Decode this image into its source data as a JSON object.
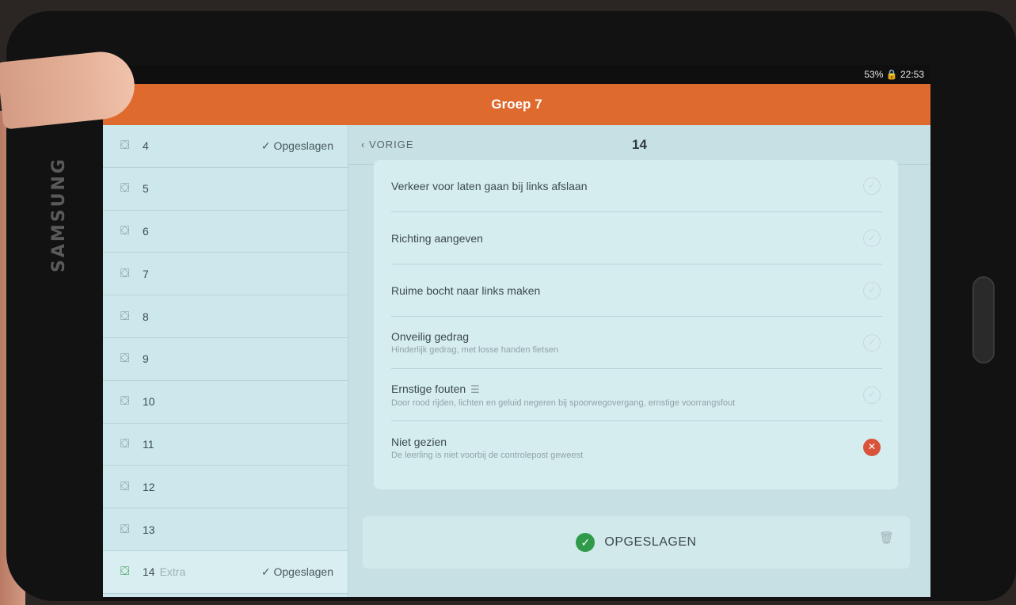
{
  "device": {
    "brand": "SAMSUNG"
  },
  "statusbar": {
    "text": "53% 🔒 22:53"
  },
  "app": {
    "title": "Groep 7"
  },
  "sidebar": {
    "items": [
      {
        "number": "4",
        "extra": "",
        "status": "✓ Opgeslagen"
      },
      {
        "number": "5",
        "extra": "",
        "status": ""
      },
      {
        "number": "6",
        "extra": "",
        "status": ""
      },
      {
        "number": "7",
        "extra": "",
        "status": ""
      },
      {
        "number": "8",
        "extra": "",
        "status": ""
      },
      {
        "number": "9",
        "extra": "",
        "status": ""
      },
      {
        "number": "10",
        "extra": "",
        "status": ""
      },
      {
        "number": "11",
        "extra": "",
        "status": ""
      },
      {
        "number": "12",
        "extra": "",
        "status": ""
      },
      {
        "number": "13",
        "extra": "",
        "status": ""
      },
      {
        "number": "14",
        "extra": "Extra",
        "status": "✓ Opgeslagen"
      }
    ]
  },
  "main": {
    "back_label": "VORIGE",
    "title": "14",
    "rows": [
      {
        "title": "Verkeer voor laten gaan bij links afslaan",
        "sub": "",
        "state": "unchecked"
      },
      {
        "title": "Richting aangeven",
        "sub": "",
        "state": "unchecked"
      },
      {
        "title": "Ruime bocht naar links maken",
        "sub": "",
        "state": "unchecked"
      },
      {
        "title": "Onveilig gedrag",
        "sub": "Hinderlijk gedrag, met losse handen fietsen",
        "state": "unchecked"
      },
      {
        "title": "Ernstige fouten",
        "sub": "Door rood rijden, lichten en geluid negeren bij spoorwegovergang, ernstige voorrangsfout",
        "state": "unchecked"
      },
      {
        "title": "Niet gezien",
        "sub": "De leerling is niet voorbij de controlepost geweest",
        "state": "marked"
      }
    ],
    "saved_label": "OPGESLAGEN"
  },
  "colors": {
    "appbar": "#de6a2e",
    "success": "#2f9b4a",
    "danger": "#d9533a"
  }
}
